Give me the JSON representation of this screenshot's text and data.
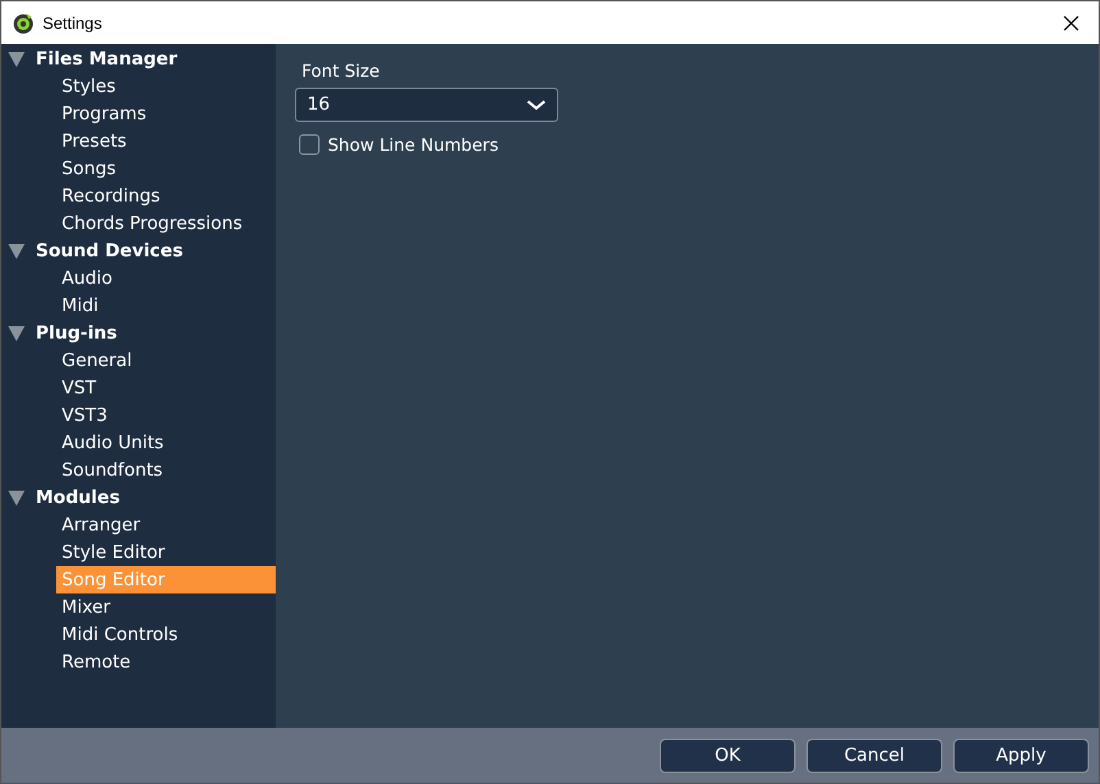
{
  "window": {
    "title": "Settings"
  },
  "sidebar": {
    "groups": [
      {
        "label": "Files Manager",
        "expanded": true,
        "children": [
          {
            "label": "Styles",
            "selected": false
          },
          {
            "label": "Programs",
            "selected": false
          },
          {
            "label": "Presets",
            "selected": false
          },
          {
            "label": "Songs",
            "selected": false
          },
          {
            "label": "Recordings",
            "selected": false
          },
          {
            "label": "Chords Progressions",
            "selected": false
          }
        ]
      },
      {
        "label": "Sound Devices",
        "expanded": true,
        "children": [
          {
            "label": "Audio",
            "selected": false
          },
          {
            "label": "Midi",
            "selected": false
          }
        ]
      },
      {
        "label": "Plug-ins",
        "expanded": true,
        "children": [
          {
            "label": "General",
            "selected": false
          },
          {
            "label": "VST",
            "selected": false
          },
          {
            "label": "VST3",
            "selected": false
          },
          {
            "label": "Audio Units",
            "selected": false
          },
          {
            "label": "Soundfonts",
            "selected": false
          }
        ]
      },
      {
        "label": "Modules",
        "expanded": true,
        "children": [
          {
            "label": "Arranger",
            "selected": false
          },
          {
            "label": "Style Editor",
            "selected": false
          },
          {
            "label": "Song Editor",
            "selected": true
          },
          {
            "label": "Mixer",
            "selected": false
          },
          {
            "label": "Midi Controls",
            "selected": false
          },
          {
            "label": "Remote",
            "selected": false
          }
        ]
      }
    ]
  },
  "content": {
    "font_size": {
      "label": "Font Size",
      "value": "16"
    },
    "show_line_numbers": {
      "label": "Show Line Numbers",
      "checked": false
    }
  },
  "buttons": [
    "OK",
    "Cancel",
    "Apply"
  ]
}
